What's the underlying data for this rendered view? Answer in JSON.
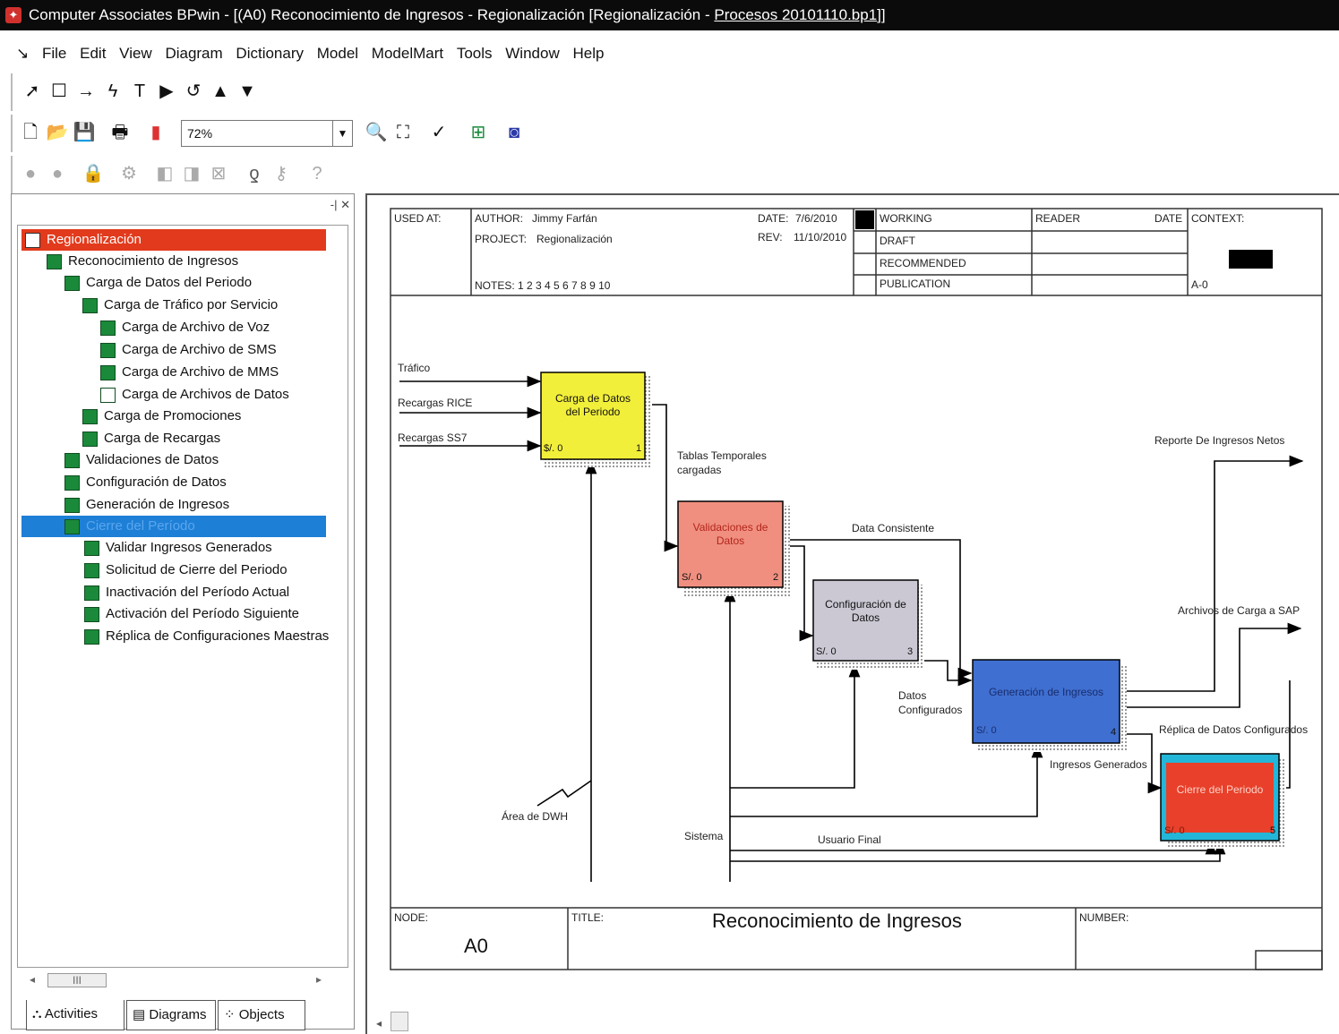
{
  "window": {
    "title_prefix": "Computer Associates BPwin - [(A0) Reconocimiento de Ingresos - Regionalización  [Regionalización - ",
    "title_file": "Procesos 20101110.bp1",
    "title_suffix": "]]"
  },
  "menu": [
    "File",
    "Edit",
    "View",
    "Diagram",
    "Dictionary",
    "Model",
    "ModelMart",
    "Tools",
    "Window",
    "Help"
  ],
  "toolbar": {
    "zoom_value": "72%"
  },
  "tree": {
    "root": "Regionalización",
    "items": [
      "Reconocimiento de Ingresos",
      "Carga de Datos del Periodo",
      "Carga de  Tráfico por Servicio",
      "Carga de Archivo de Voz",
      "Carga de Archivo de SMS",
      "Carga de Archivo de MMS",
      "Carga de Archivos de Datos",
      "Carga de  Promociones",
      "Carga de Recargas",
      "Validaciones de Datos",
      "Configuración de Datos",
      "Generación de Ingresos",
      "Cierre del Período",
      "Validar Ingresos Generados",
      "Solicitud de Cierre del Periodo",
      "Inactivación del Período Actual",
      "Activación del Período Siguiente",
      "Réplica de Configuraciones Maestras"
    ],
    "scroll_thumb": "III",
    "tabs": [
      "Activities",
      "Diagrams",
      "Objects"
    ]
  },
  "diagram": {
    "header": {
      "used_at": "USED AT:",
      "author_label": "AUTHOR:",
      "author": "Jimmy Farfán",
      "project_label": "PROJECT:",
      "project": "Regionalización",
      "date_label": "DATE:",
      "date": "7/6/2010",
      "rev_label": "REV:",
      "rev": "11/10/2010",
      "notes": "NOTES:  1  2  3  4  5  6  7  8  9  10",
      "working": "WORKING",
      "draft": "DRAFT",
      "recommended": "RECOMMENDED",
      "publication": "PUBLICATION",
      "reader": "READER",
      "date2": "DATE",
      "context": "CONTEXT:",
      "context_node": "A-0"
    },
    "boxes": [
      {
        "title": "Carga de Datos\ndel Periodo",
        "cost": "$/. 0",
        "num": "1",
        "color": "#f2ef3a"
      },
      {
        "title": "Validaciones de\nDatos",
        "cost": "S/. 0",
        "num": "2",
        "color": "#f08f80"
      },
      {
        "title": "Configuración de\nDatos",
        "cost": "S/. 0",
        "num": "3",
        "color": "#cbc8d4"
      },
      {
        "title": "Generación de Ingresos",
        "cost": "S/. 0",
        "num": "4",
        "color": "#3f6fd0"
      },
      {
        "title": "Cierre del Periodo",
        "cost": "S/. 0",
        "num": "5",
        "color": "#e8402a"
      }
    ],
    "arrows": {
      "trafico": "Tráfico",
      "recargas_rice": "Recargas RICE",
      "recargas_ss7": "Recargas SS7",
      "tablas": "Tablas Temporales\ncargadas",
      "data_consistente": "Data Consistente",
      "datos_config": "Datos\nConfigurados",
      "reporte": "Reporte De Ingresos Netos",
      "archivos_sap": "Archivos de Carga a SAP",
      "replica": "Réplica de Datos Configurados",
      "ingresos_gen": "Ingresos Generados",
      "area_dwh": "Área de DWH",
      "sistema": "Sistema",
      "usuario": "Usuario Final"
    },
    "footer": {
      "node_label": "NODE:",
      "node": "A0",
      "title_label": "TITLE:",
      "title": "Reconocimiento de Ingresos",
      "number_label": "NUMBER:"
    }
  }
}
